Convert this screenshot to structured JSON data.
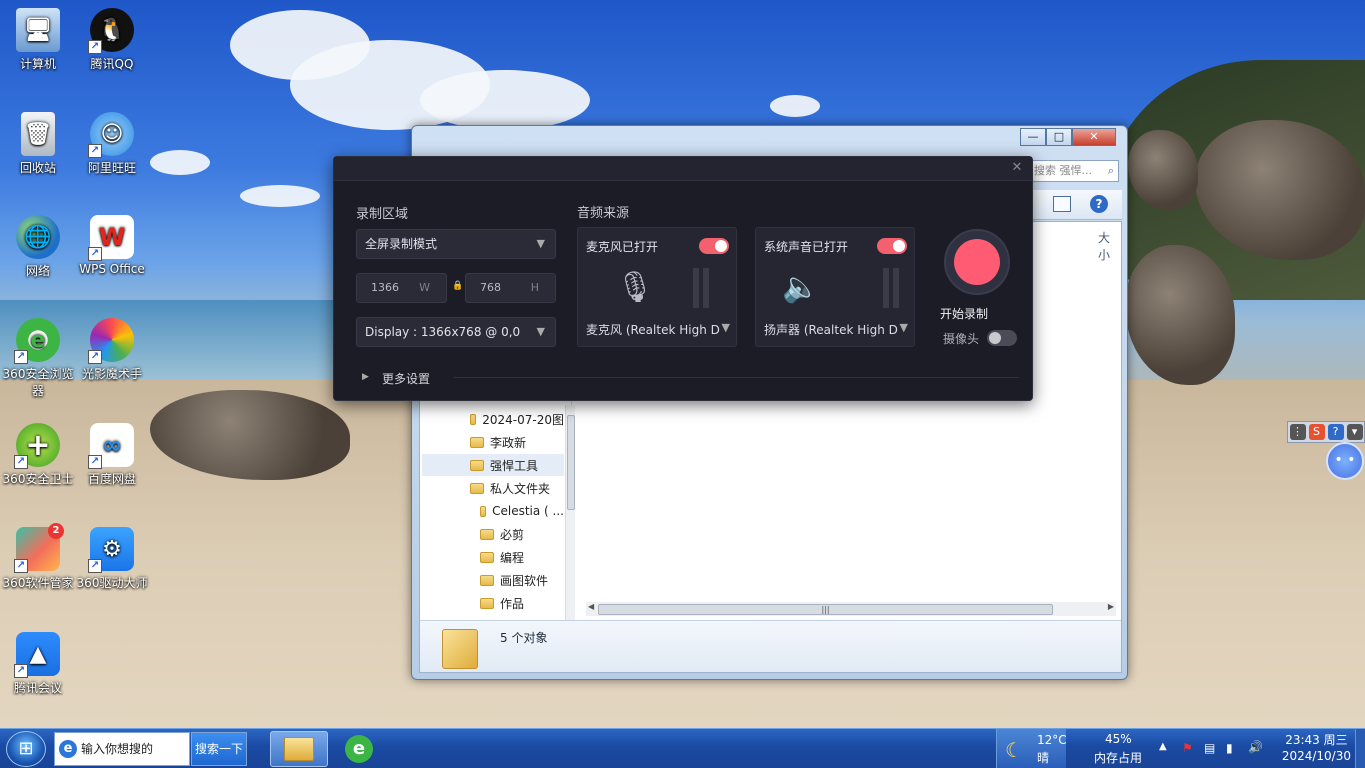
{
  "desktop_icons": [
    {
      "label": "计算机",
      "icon": "computer-icon"
    },
    {
      "label": "腾讯QQ",
      "icon": "qq-icon"
    },
    {
      "label": "回收站",
      "icon": "recycle-bin-icon"
    },
    {
      "label": "阿里旺旺",
      "icon": "aliwangwang-icon"
    },
    {
      "label": "网络",
      "icon": "network-icon"
    },
    {
      "label": "WPS Office",
      "icon": "wps-icon"
    },
    {
      "label": "360安全浏览器",
      "icon": "360-browser-icon"
    },
    {
      "label": "光影魔术手",
      "icon": "photo-tool-icon"
    },
    {
      "label": "360安全卫士",
      "icon": "360-guard-icon"
    },
    {
      "label": "百度网盘",
      "icon": "baidu-netdisk-icon"
    },
    {
      "label": "360软件管家",
      "icon": "360-software-icon",
      "badge": "2"
    },
    {
      "label": "360驱动大师",
      "icon": "360-driver-icon"
    },
    {
      "label": "腾讯会议",
      "icon": "tencent-meeting-icon"
    }
  ],
  "explorer": {
    "search_placeholder": "搜索 强悍...",
    "column_header": "大小",
    "tree_items": [
      "2024-07-20图",
      "李政新",
      "强悍工具",
      "私人文件夹",
      "Celestia ( ...",
      "必剪",
      "编程",
      "画图软件",
      "作品"
    ],
    "selected_item": "强悍工具",
    "status_text": "5 个对象"
  },
  "recorder": {
    "area_heading": "录制区域",
    "mode_select": "全屏录制模式",
    "width_value": "1366",
    "width_unit": "W",
    "height_value": "768",
    "height_unit": "H",
    "display_select": "Display : 1366x768 @ 0,0",
    "audio_heading": "音频来源",
    "mic": {
      "title": "麦克风已打开",
      "device": "麦克风 (Realtek High D",
      "enabled": true
    },
    "speaker": {
      "title": "系统声音已打开",
      "device": "扬声器 (Realtek High D",
      "enabled": true
    },
    "record_label": "开始录制",
    "camera_label": "摄像头",
    "camera_enabled": false,
    "more_settings": "更多设置",
    "accent_color": "#ff5c74"
  },
  "taskbar": {
    "search_placeholder": "输入你想搜的",
    "search_button": "搜索一下",
    "weather_temp": "12°C",
    "weather_desc": "晴",
    "memory_percent": "45%",
    "memory_label": "内存占用",
    "time": "23:43",
    "weekday": "周三",
    "date": "2024/10/30"
  }
}
